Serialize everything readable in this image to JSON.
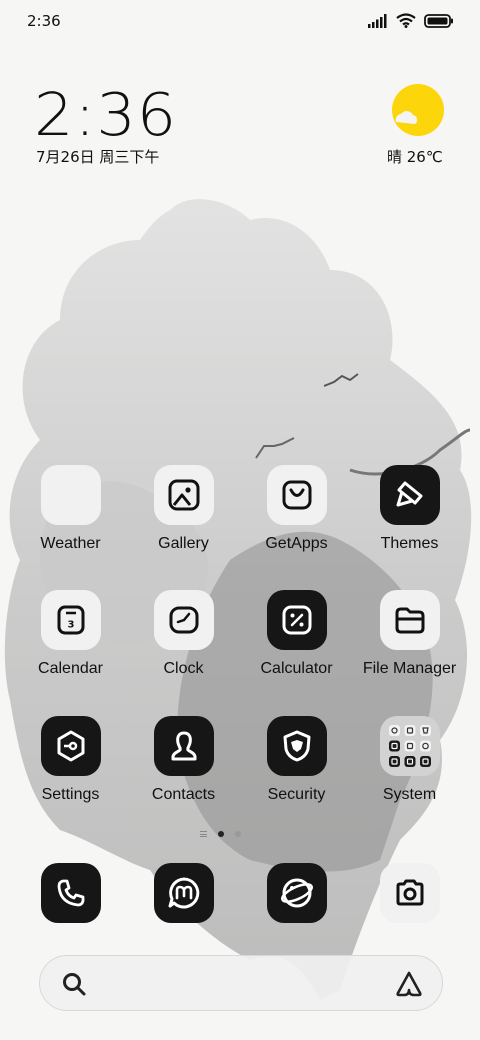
{
  "status_bar": {
    "time": "2:36"
  },
  "clock_widget": {
    "time": "2:36",
    "date": "7月26日 周三下午"
  },
  "weather_widget": {
    "text": "晴 26℃",
    "sun_color": "#fcd50a"
  },
  "apps": [
    {
      "label": "Weather",
      "icon": "weather-icon"
    },
    {
      "label": "Gallery",
      "icon": "gallery-icon"
    },
    {
      "label": "GetApps",
      "icon": "getapps-icon"
    },
    {
      "label": "Themes",
      "icon": "themes-icon"
    },
    {
      "label": "Calendar",
      "icon": "calendar-icon",
      "day": "3"
    },
    {
      "label": "Clock",
      "icon": "clock-icon"
    },
    {
      "label": "Calculator",
      "icon": "calculator-icon"
    },
    {
      "label": "File Manager",
      "icon": "file-manager-icon"
    },
    {
      "label": "Settings",
      "icon": "settings-icon"
    },
    {
      "label": "Contacts",
      "icon": "contacts-icon"
    },
    {
      "label": "Security",
      "icon": "security-icon"
    },
    {
      "label": "System",
      "icon": "system-folder-icon"
    }
  ],
  "dock": [
    {
      "icon": "phone-icon"
    },
    {
      "icon": "messages-icon"
    },
    {
      "icon": "browser-icon"
    },
    {
      "icon": "camera-icon"
    }
  ],
  "pager": {
    "pages": 2,
    "active": 1
  },
  "search": {
    "placeholder": ""
  }
}
